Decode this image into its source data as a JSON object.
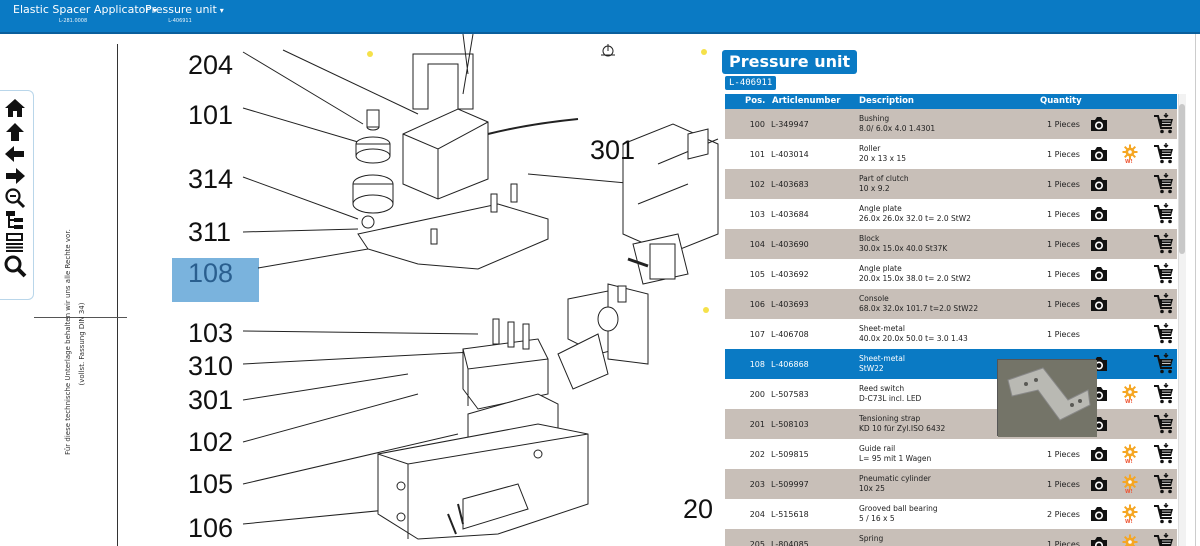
{
  "header": {
    "crumb1": {
      "label": "Elastic Spacer Applicator",
      "code": "L-281.0008"
    },
    "crumb2": {
      "label": "Pressure unit",
      "code": "L-406911"
    }
  },
  "toolbar": {
    "icons": [
      "home-icon",
      "arrow-up-icon",
      "arrow-left-icon",
      "arrow-right-icon",
      "zoom-out-icon",
      "tree-icon",
      "list-icon",
      "search-icon"
    ]
  },
  "copyright": {
    "line1": "Für diese technische Unterlage behalten wir uns alle Rechte vor.",
    "line2": "(vollst. Fassung DIN 34)"
  },
  "drawing": {
    "labels": [
      "204",
      "101",
      "314",
      "311",
      "108",
      "103",
      "310",
      "301",
      "102",
      "105",
      "106",
      "301",
      "20"
    ],
    "highlighted": "108"
  },
  "panel": {
    "title": "Pressure unit",
    "code": "L-406911",
    "columns": {
      "pos": "Pos.",
      "article": "Articlenumber",
      "description": "Description",
      "quantity": "Quantity"
    },
    "rows": [
      {
        "pos": "100",
        "article": "L-349947",
        "desc1": "Bushing",
        "desc2": "8.0/ 6.0x 4.0 1.4301",
        "qty": "1 Pieces",
        "photo": true,
        "wear": false
      },
      {
        "pos": "101",
        "article": "L-403014",
        "desc1": "Roller",
        "desc2": "20 x 13 x 15",
        "qty": "1 Pieces",
        "photo": true,
        "wear": true
      },
      {
        "pos": "102",
        "article": "L-403683",
        "desc1": "Part of clutch",
        "desc2": "10 x 9.2",
        "qty": "1 Pieces",
        "photo": true,
        "wear": false
      },
      {
        "pos": "103",
        "article": "L-403684",
        "desc1": "Angle plate",
        "desc2": "26.0x 26.0x 32.0 t= 2.0 StW2",
        "qty": "1 Pieces",
        "photo": true,
        "wear": false
      },
      {
        "pos": "104",
        "article": "L-403690",
        "desc1": "Block",
        "desc2": "30.0x 15.0x 40.0 St37K",
        "qty": "1 Pieces",
        "photo": true,
        "wear": false
      },
      {
        "pos": "105",
        "article": "L-403692",
        "desc1": "Angle plate",
        "desc2": "20.0x 15.0x 38.0 t= 2.0 StW2",
        "qty": "1 Pieces",
        "photo": true,
        "wear": false
      },
      {
        "pos": "106",
        "article": "L-403693",
        "desc1": "Console",
        "desc2": "68.0x 32.0x 101.7 t=2.0 StW22",
        "qty": "1 Pieces",
        "photo": true,
        "wear": false
      },
      {
        "pos": "107",
        "article": "L-406708",
        "desc1": "Sheet-metal",
        "desc2": "40.0x 20.0x 50.0 t= 3.0 1.43",
        "qty": "1 Pieces",
        "photo": false,
        "wear": false
      },
      {
        "pos": "108",
        "article": "L-406868",
        "desc1": "Sheet-metal",
        "desc2": "StW22",
        "qty": "",
        "photo": true,
        "wear": false,
        "selected": true
      },
      {
        "pos": "200",
        "article": "L-507583",
        "desc1": "Reed switch",
        "desc2": "D-C73L incl. LED",
        "qty": "",
        "photo": true,
        "wear": true
      },
      {
        "pos": "201",
        "article": "L-508103",
        "desc1": "Tensioning strap",
        "desc2": "KD 10 für Zyl.ISO 6432",
        "qty": "",
        "photo": true,
        "wear": false
      },
      {
        "pos": "202",
        "article": "L-509815",
        "desc1": "Guide rail",
        "desc2": "L= 95 mit 1 Wagen",
        "qty": "1 Pieces",
        "photo": true,
        "wear": true
      },
      {
        "pos": "203",
        "article": "L-509997",
        "desc1": "Pneumatic cylinder",
        "desc2": "10x 25",
        "qty": "1 Pieces",
        "photo": true,
        "wear": true
      },
      {
        "pos": "204",
        "article": "L-515618",
        "desc1": "Grooved ball bearing",
        "desc2": "5 / 16 x 5",
        "qty": "2 Pieces",
        "photo": true,
        "wear": true
      },
      {
        "pos": "205",
        "article": "L-804085",
        "desc1": "Spring",
        "desc2": "",
        "qty": "1 Pieces",
        "photo": true,
        "wear": true
      }
    ],
    "wear_badge": "W!"
  },
  "colors": {
    "brand": "#0a7ac4",
    "row_dark": "#c8bfb8",
    "highlight": "#7ab3dd",
    "gear": "#f5a623"
  }
}
